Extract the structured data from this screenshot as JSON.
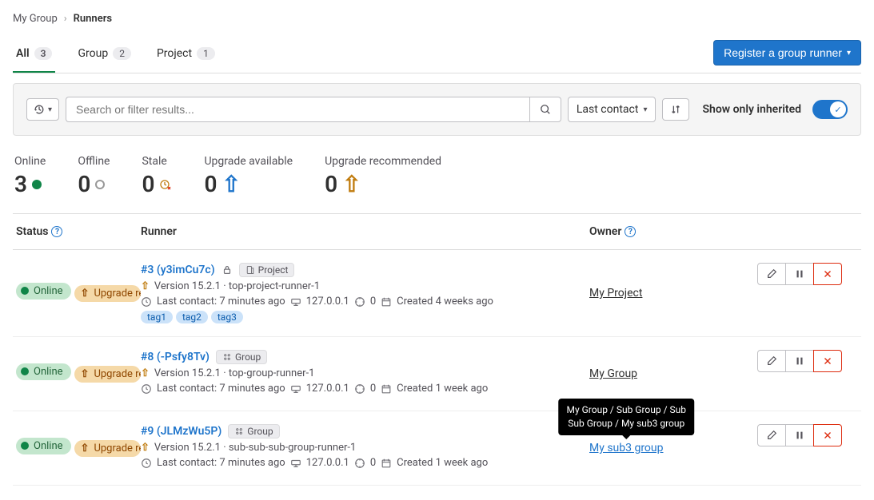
{
  "breadcrumb": {
    "parent": "My Group",
    "current": "Runners"
  },
  "tabs": {
    "all": {
      "label": "All",
      "count": "3"
    },
    "group": {
      "label": "Group",
      "count": "2"
    },
    "project": {
      "label": "Project",
      "count": "1"
    }
  },
  "register_button": "Register a group runner",
  "search": {
    "placeholder": "Search or filter results..."
  },
  "sort": {
    "label": "Last contact"
  },
  "inherited_label": "Show only inherited",
  "stats": {
    "online": {
      "label": "Online",
      "value": "3"
    },
    "offline": {
      "label": "Offline",
      "value": "0"
    },
    "stale": {
      "label": "Stale",
      "value": "0"
    },
    "upgrade_available": {
      "label": "Upgrade available",
      "value": "0"
    },
    "upgrade_recommended": {
      "label": "Upgrade recommended",
      "value": "0"
    }
  },
  "headers": {
    "status": "Status",
    "runner": "Runner",
    "owner": "Owner"
  },
  "status_text": {
    "online": "Online",
    "upgrade": "Upgrade reco…"
  },
  "type_labels": {
    "project": "Project",
    "group": "Group"
  },
  "runners": [
    {
      "id": "#3 (y3imCu7c)",
      "locked": true,
      "type": "project",
      "version_line": "Version 15.2.1 · top-project-runner-1",
      "contact": "Last contact: 7 minutes ago",
      "ip": "127.0.0.1",
      "jobs": "0",
      "created": "Created 4 weeks ago",
      "owner": "My Project",
      "tags": [
        "tag1",
        "tag2",
        "tag3"
      ]
    },
    {
      "id": "#8 (-Psfy8Tv)",
      "locked": false,
      "type": "group",
      "version_line": "Version 15.2.1 · top-group-runner-1",
      "contact": "Last contact: 7 minutes ago",
      "ip": "127.0.0.1",
      "jobs": "0",
      "created": "Created 1 week ago",
      "owner": "My Group",
      "tags": []
    },
    {
      "id": "#9 (JLMzWu5P)",
      "locked": false,
      "type": "group",
      "version_line": "Version 15.2.1 · sub-sub-sub-group-runner-1",
      "contact": "Last contact: 7 minutes ago",
      "ip": "127.0.0.1",
      "jobs": "0",
      "created": "Created 1 week ago",
      "owner": "My sub3 group",
      "owner_tooltip": "My Group / Sub Group / Sub\nSub Group / My sub3 group",
      "tags": []
    }
  ]
}
